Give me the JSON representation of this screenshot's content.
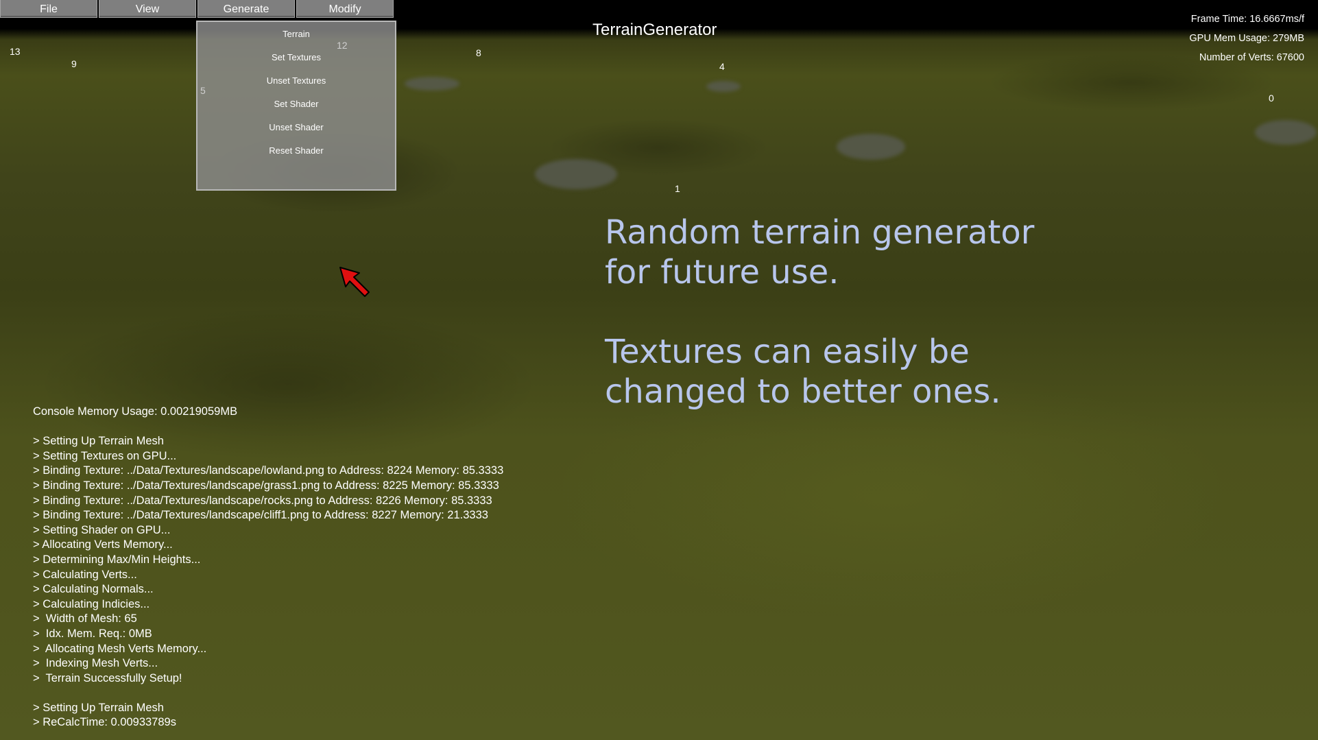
{
  "menu": {
    "items": [
      "File",
      "View",
      "Generate",
      "Modify"
    ]
  },
  "dropdown": {
    "items": [
      "Terrain",
      "Set Textures",
      "Unset Textures",
      "Set Shader",
      "Unset Shader",
      "Reset Shader"
    ]
  },
  "window_title": "TerrainGenerator",
  "stats": {
    "frame_time": "Frame Time: 16.6667ms/f",
    "gpu_mem": "GPU Mem Usage: 279MB",
    "verts": "Number of Verts: 67600"
  },
  "markers": [
    "13",
    "9",
    "12",
    "5",
    "8",
    "4",
    "0",
    "1"
  ],
  "overlay_text": {
    "line1": "Random terrain generator",
    "line2": "for future use.",
    "line3": "Textures can easily be",
    "line4": "changed to better ones."
  },
  "console": {
    "memory": "Console Memory Usage: 0.00219059MB",
    "lines": [
      "> Setting Up Terrain Mesh",
      "> Setting Textures on GPU...",
      "> Binding Texture: ../Data/Textures/landscape/lowland.png to Address: 8224 Memory: 85.3333",
      "> Binding Texture: ../Data/Textures/landscape/grass1.png to Address: 8225 Memory: 85.3333",
      "> Binding Texture: ../Data/Textures/landscape/rocks.png to Address: 8226 Memory: 85.3333",
      "> Binding Texture: ../Data/Textures/landscape/cliff1.png to Address: 8227 Memory: 21.3333",
      "> Setting Shader on GPU...",
      "> Allocating Verts Memory...",
      "> Determining Max/Min Heights...",
      "> Calculating Verts...",
      "> Calculating Normals...",
      "> Calculating Indicies...",
      ">  Width of Mesh: 65",
      ">  Idx. Mem. Req.: 0MB",
      ">  Allocating Mesh Verts Memory...",
      ">  Indexing Mesh Verts...",
      ">  Terrain Successfully Setup!"
    ],
    "lines2": [
      "> Setting Up Terrain Mesh",
      "> ReCalcTime: 0.00933789s"
    ]
  },
  "colors": {
    "terrain": "#4a4f1a",
    "menu_bg": "#7f7f7f",
    "overlay_text": "#b8c6ec",
    "cursor": "#e01010"
  }
}
